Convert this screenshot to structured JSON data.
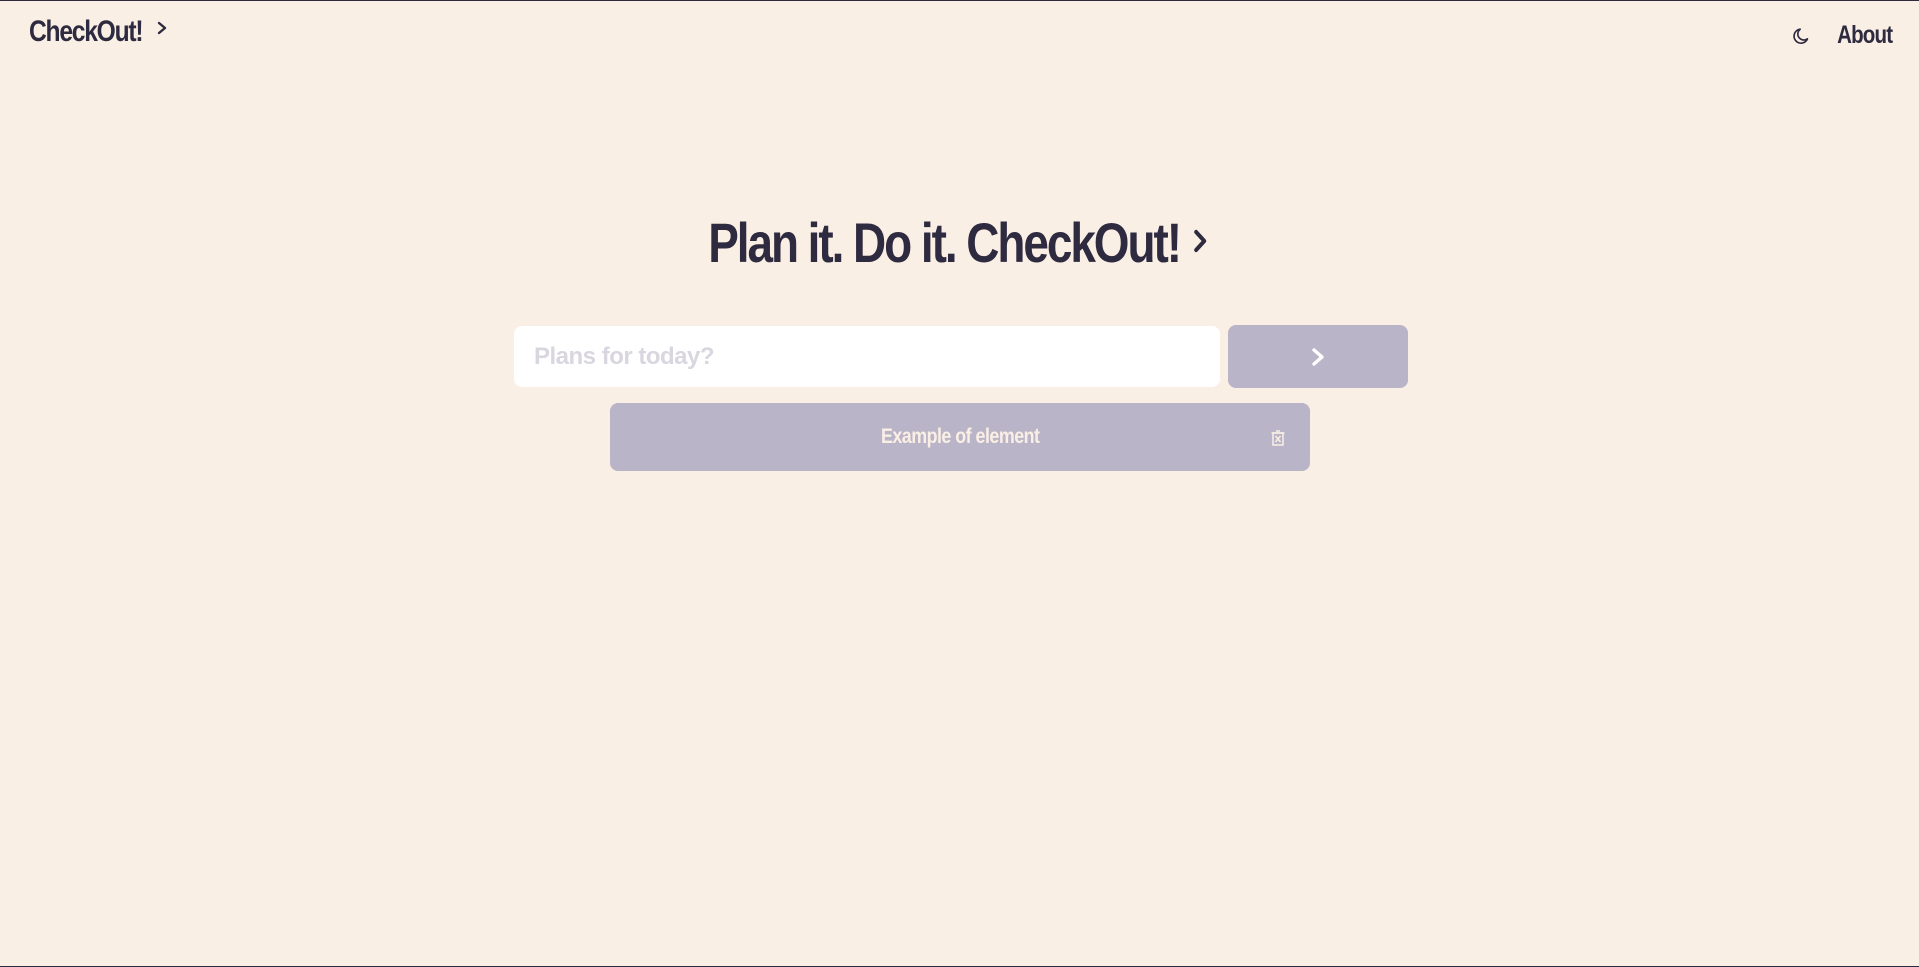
{
  "header": {
    "brand": "CheckOut!",
    "about_label": "About",
    "theme_icon": "moon-icon"
  },
  "hero": {
    "title": "Plan it. Do it. CheckOut!"
  },
  "form": {
    "input_value": "",
    "placeholder": "Plans for today?",
    "submit_icon": "chevron-right-icon"
  },
  "tasks": [
    {
      "label": "Example of element",
      "delete_icon": "trash-icon"
    }
  ],
  "colors": {
    "background": "#FAEFE5",
    "text": "#2E2A3F",
    "accent_muted": "#BAB4C8",
    "input_bg": "#FFFFFF",
    "placeholder": "#D9D6E0"
  }
}
